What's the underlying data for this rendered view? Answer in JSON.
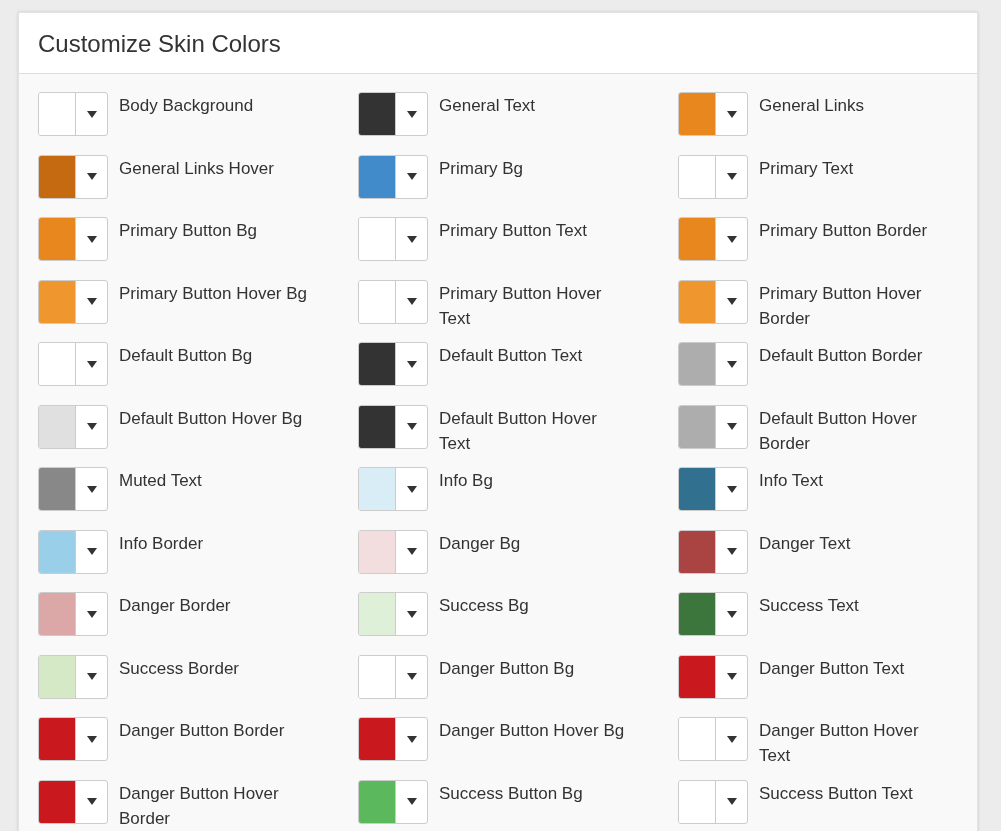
{
  "title": "Customize Skin Colors",
  "items": [
    {
      "label": "Body Background",
      "color": "#ffffff"
    },
    {
      "label": "General Text",
      "color": "#333333"
    },
    {
      "label": "General Links",
      "color": "#e8871e"
    },
    {
      "label": "General Links Hover",
      "color": "#c56a10"
    },
    {
      "label": "Primary Bg",
      "color": "#428bca"
    },
    {
      "label": "Primary Text",
      "color": "#ffffff"
    },
    {
      "label": "Primary Button Bg",
      "color": "#e8871e"
    },
    {
      "label": "Primary Button Text",
      "color": "#ffffff"
    },
    {
      "label": "Primary Button Border",
      "color": "#e8871e"
    },
    {
      "label": "Primary Button Hover Bg",
      "color": "#f0962f"
    },
    {
      "label": "Primary Button Hover Text",
      "color": "#ffffff"
    },
    {
      "label": "Primary Button Hover Border",
      "color": "#f0962f"
    },
    {
      "label": "Default Button Bg",
      "color": "#ffffff"
    },
    {
      "label": "Default Button Text",
      "color": "#333333"
    },
    {
      "label": "Default Button Border",
      "color": "#adadad"
    },
    {
      "label": "Default Button Hover Bg",
      "color": "#e0e0e0"
    },
    {
      "label": "Default Button Hover Text",
      "color": "#333333"
    },
    {
      "label": "Default Button Hover Border",
      "color": "#adadad"
    },
    {
      "label": "Muted Text",
      "color": "#888888"
    },
    {
      "label": "Info Bg",
      "color": "#d9edf7"
    },
    {
      "label": "Info Text",
      "color": "#31708f"
    },
    {
      "label": "Info Border",
      "color": "#9acfea"
    },
    {
      "label": "Danger Bg",
      "color": "#f2dede"
    },
    {
      "label": "Danger Text",
      "color": "#a94442"
    },
    {
      "label": "Danger Border",
      "color": "#dca7a7"
    },
    {
      "label": "Success Bg",
      "color": "#dff0d8"
    },
    {
      "label": "Success Text",
      "color": "#3c763d"
    },
    {
      "label": "Success Border",
      "color": "#d6e9c6"
    },
    {
      "label": "Danger Button Bg",
      "color": "#ffffff"
    },
    {
      "label": "Danger Button Text",
      "color": "#c9191e"
    },
    {
      "label": "Danger Button Border",
      "color": "#c9191e"
    },
    {
      "label": "Danger Button Hover Bg",
      "color": "#c9191e"
    },
    {
      "label": "Danger Button Hover Text",
      "color": "#ffffff"
    },
    {
      "label": "Danger Button Hover Border",
      "color": "#c9191e"
    },
    {
      "label": "Success Button Bg",
      "color": "#5cb85c"
    },
    {
      "label": "Success Button Text",
      "color": "#ffffff"
    }
  ]
}
